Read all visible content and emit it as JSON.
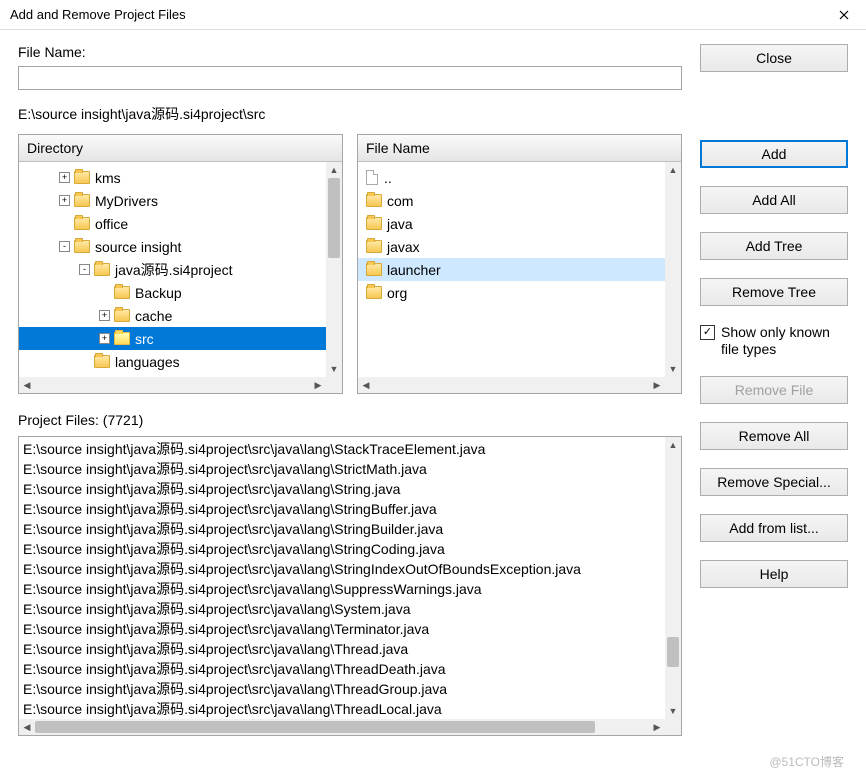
{
  "window": {
    "title": "Add and Remove Project Files"
  },
  "filename": {
    "label": "File Name:",
    "value": ""
  },
  "path": "E:\\source insight\\java源码.si4project\\src",
  "directory": {
    "header": "Directory",
    "items": [
      {
        "indent": 40,
        "expand": "+",
        "label": "kms"
      },
      {
        "indent": 40,
        "expand": "+",
        "label": "MyDrivers"
      },
      {
        "indent": 40,
        "expand": "",
        "label": "office"
      },
      {
        "indent": 40,
        "expand": "-",
        "label": "source insight"
      },
      {
        "indent": 60,
        "expand": "-",
        "label": "java源码.si4project"
      },
      {
        "indent": 80,
        "expand": "",
        "label": "Backup"
      },
      {
        "indent": 80,
        "expand": "+",
        "label": "cache"
      },
      {
        "indent": 80,
        "expand": "+",
        "label": "src",
        "selected": true
      },
      {
        "indent": 60,
        "expand": "",
        "label": "languages"
      }
    ]
  },
  "filepane": {
    "header": "File Name",
    "items": [
      {
        "type": "file",
        "label": ".."
      },
      {
        "type": "folder",
        "label": "com"
      },
      {
        "type": "folder",
        "label": "java"
      },
      {
        "type": "folder",
        "label": "javax"
      },
      {
        "type": "folder",
        "label": "launcher",
        "selected": true
      },
      {
        "type": "folder",
        "label": "org"
      }
    ]
  },
  "projectfiles": {
    "label": "Project Files: (7721)",
    "items": [
      "E:\\source insight\\java源码.si4project\\src\\java\\lang\\StackTraceElement.java",
      "E:\\source insight\\java源码.si4project\\src\\java\\lang\\StrictMath.java",
      "E:\\source insight\\java源码.si4project\\src\\java\\lang\\String.java",
      "E:\\source insight\\java源码.si4project\\src\\java\\lang\\StringBuffer.java",
      "E:\\source insight\\java源码.si4project\\src\\java\\lang\\StringBuilder.java",
      "E:\\source insight\\java源码.si4project\\src\\java\\lang\\StringCoding.java",
      "E:\\source insight\\java源码.si4project\\src\\java\\lang\\StringIndexOutOfBoundsException.java",
      "E:\\source insight\\java源码.si4project\\src\\java\\lang\\SuppressWarnings.java",
      "E:\\source insight\\java源码.si4project\\src\\java\\lang\\System.java",
      "E:\\source insight\\java源码.si4project\\src\\java\\lang\\Terminator.java",
      "E:\\source insight\\java源码.si4project\\src\\java\\lang\\Thread.java",
      "E:\\source insight\\java源码.si4project\\src\\java\\lang\\ThreadDeath.java",
      "E:\\source insight\\java源码.si4project\\src\\java\\lang\\ThreadGroup.java",
      "E:\\source insight\\java源码.si4project\\src\\java\\lang\\ThreadLocal.java"
    ]
  },
  "buttons": {
    "close": "Close",
    "add": "Add",
    "addall": "Add All",
    "addtree": "Add Tree",
    "removetree": "Remove Tree",
    "removefile": "Remove File",
    "removeall": "Remove All",
    "removespecial": "Remove Special...",
    "addfromlist": "Add from list...",
    "help": "Help"
  },
  "checkbox": {
    "label": "Show only known file types",
    "checked": true
  }
}
